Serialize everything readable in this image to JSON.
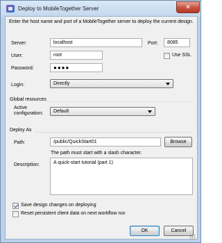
{
  "window": {
    "title": "Deploy to MobileTogether Server",
    "close_glyph": "✕"
  },
  "intro": "Enter the host name and port of a MobileTogether server to deploy the current design.",
  "server": {
    "label": "Server:",
    "value": "localhost"
  },
  "port": {
    "label": "Port:",
    "value": "8085"
  },
  "user": {
    "label": "User:",
    "value": "root"
  },
  "use_ssl": {
    "label": "Use SSL",
    "checked": false
  },
  "password": {
    "label": "Password:",
    "value": "●●●●"
  },
  "login": {
    "label": "Login:",
    "value": "Directly"
  },
  "global_resources": {
    "heading": "Global resources",
    "active_label_line1": "Active",
    "active_label_line2": "configuration:",
    "value": "Default"
  },
  "deploy_as": {
    "heading": "Deploy As",
    "path_label": "Path:",
    "path_value": "/public/QuickStart01",
    "browse_label": "Browse",
    "path_hint": "The path must start with a slash character.",
    "description_label": "Description:",
    "description_value": "A quick-start tutorial (part 1)"
  },
  "options": {
    "save_changes": {
      "label": "Save design changes on deploying",
      "checked": true
    },
    "reset_data": {
      "label": "Reset persistent client data on next workflow run",
      "checked": false
    }
  },
  "buttons": {
    "ok": "OK",
    "cancel": "Cancel"
  }
}
